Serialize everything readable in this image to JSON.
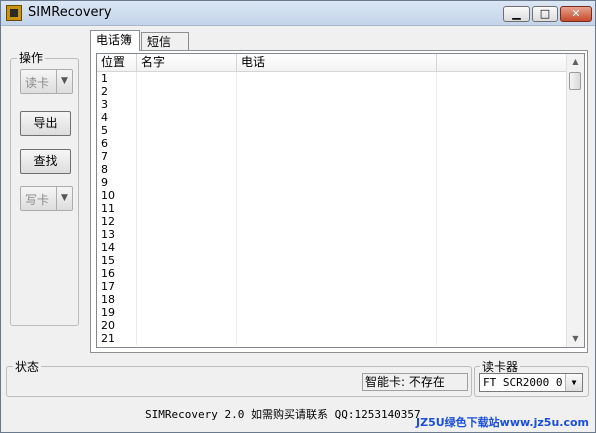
{
  "window": {
    "title": "SIMRecovery",
    "min_icon": "minimize-icon",
    "max_icon": "maximize-icon",
    "close_icon": "close-icon"
  },
  "operations": {
    "group_label": "操作",
    "read_card": "读卡",
    "export": "导出",
    "find": "查找",
    "write_card": "写卡"
  },
  "tabs": [
    "电话簿",
    "短信"
  ],
  "list": {
    "columns": [
      "位置",
      "名字",
      "电话"
    ],
    "rows": [
      "1",
      "2",
      "3",
      "4",
      "5",
      "6",
      "7",
      "8",
      "9",
      "10",
      "11",
      "12",
      "13",
      "14",
      "15",
      "16",
      "17",
      "18",
      "19",
      "20",
      "21"
    ]
  },
  "status": {
    "group_label": "状态",
    "smart_card": "智能卡: 不存在"
  },
  "reader": {
    "group_label": "读卡器",
    "selected": "FT SCR2000 0"
  },
  "footer": {
    "text": "SIMRecovery 2.0   如需购买请联系 QQ:1253140357"
  },
  "watermark": "JZ5U绿色下载站www.jz5u.com",
  "colors": {
    "watermark": "#1b4fd8",
    "close_button": "#c44a2b"
  }
}
